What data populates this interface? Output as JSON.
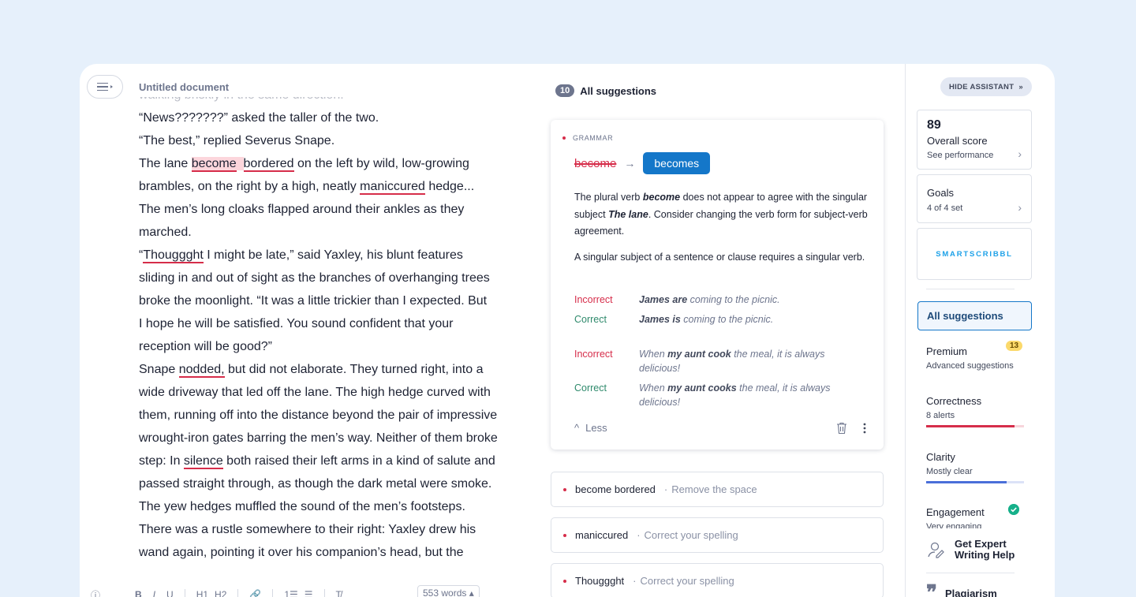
{
  "editor": {
    "title": "Untitled document",
    "faded_line": "walking briskly in the same direction.",
    "lines": [
      [
        {
          "t": "“News???????” asked the taller of the two."
        }
      ],
      [
        {
          "t": "“The best,” replied Severus Snape."
        }
      ],
      [
        {
          "t": "The lane "
        },
        {
          "t": "become",
          "s": "uh"
        },
        {
          "t": "  ",
          "s": "h"
        },
        {
          "t": "bordered",
          "s": "u"
        },
        {
          "t": " on the left by wild, low-growing"
        }
      ],
      [
        {
          "t": "brambles, on the right by a high, neatly "
        },
        {
          "t": "maniccured",
          "s": "u"
        },
        {
          "t": " hedge..."
        }
      ],
      [
        {
          "t": "The men’s long cloaks flapped around their ankles as they"
        }
      ],
      [
        {
          "t": "marched."
        }
      ],
      [
        {
          "t": "“"
        },
        {
          "t": "Thouggght",
          "s": "u"
        },
        {
          "t": " I might be late,” said Yaxley, his blunt features"
        }
      ],
      [
        {
          "t": "sliding in and out of sight as the branches of overhanging trees"
        }
      ],
      [
        {
          "t": "broke the moonlight. “It was a little trickier than I expected. But"
        }
      ],
      [
        {
          "t": "I hope he will be satisfied. You sound confident that your"
        }
      ],
      [
        {
          "t": "reception will be good?”"
        }
      ],
      [
        {
          "t": "Snape "
        },
        {
          "t": "nodded,",
          "s": "u"
        },
        {
          "t": " but did not elaborate. They turned right, into a"
        }
      ],
      [
        {
          "t": "wide driveway that led off the lane. The high hedge curved with"
        }
      ],
      [
        {
          "t": "them, running off into the distance beyond the pair of impressive"
        }
      ],
      [
        {
          "t": "wrought-iron gates barring the men’s way. Neither of them broke"
        }
      ],
      [
        {
          "t": "step: In "
        },
        {
          "t": "silence",
          "s": "u"
        },
        {
          "t": " both raised their left arms in a kind of salute and"
        }
      ],
      [
        {
          "t": "passed straight through, as though the dark metal were smoke."
        }
      ],
      [
        {
          "t": "The yew hedges muffled the sound of the men’s footsteps."
        }
      ],
      [
        {
          "t": "There was a rustle somewhere to their right: Yaxley drew his"
        }
      ],
      [
        {
          "t": "wand again, pointing it over his companion’s head, but the"
        }
      ]
    ],
    "toolbar": {
      "bold": "B",
      "italic": "I",
      "underline": "U",
      "h1": "H1",
      "h2": "H2",
      "link": "🔗",
      "ordered_list": "1☰",
      "bullet_list": "☰",
      "clear": "T̸"
    },
    "word_count": "553 words"
  },
  "suggestions": {
    "count": "10",
    "title": "All suggestions",
    "main_card": {
      "category": "GRAMMAR",
      "original": "become",
      "arrow": "→",
      "replacement": "becomes",
      "explanation_html": "The plural verb <b><i>become</i></b> does not appear to agree with the singular subject <b><i>The lane</i></b>. Consider changing the verb form for subject-verb agreement.",
      "explanation2": "A singular subject of a sentence or clause requires a singular verb.",
      "examples": [
        {
          "label": "Incorrect",
          "html": "<b>James are</b> coming to the picnic."
        },
        {
          "label": "Correct",
          "html": "<b>James is</b> coming to the picnic."
        },
        {
          "label": "Incorrect",
          "html": "When <b>my aunt cook</b> the meal, it is always delicious!"
        },
        {
          "label": "Correct",
          "html": "When <b>my aunt cooks</b> the meal, it is always delicious!"
        }
      ],
      "less_label": "Less"
    },
    "cards": [
      {
        "term": "become bordered",
        "sep": "·",
        "hint": "Remove the space"
      },
      {
        "term": "maniccured",
        "sep": "·",
        "hint": "Correct your spelling"
      },
      {
        "term": "Thouggght",
        "sep": "·",
        "hint": "Correct your spelling"
      }
    ]
  },
  "panel": {
    "hide_label": "HIDE ASSISTANT",
    "hide_chevrons": "»",
    "score": {
      "value": "89",
      "label": "Overall score",
      "sub": "See performance"
    },
    "goals": {
      "label": "Goals",
      "sub": "4 of 4 set"
    },
    "brand": "SMARTSCRIBBL",
    "all_suggestions": "All suggestions",
    "premium": {
      "label": "Premium",
      "sub": "Advanced suggestions",
      "badge": "13"
    },
    "correctness": {
      "label": "Correctness",
      "sub": "8 alerts",
      "level": 0.9,
      "color": "#d62d4a"
    },
    "clarity": {
      "label": "Clarity",
      "sub": "Mostly clear",
      "level": 0.82,
      "color": "#4a6fd9"
    },
    "engagement": {
      "label": "Engagement",
      "sub": "Very engaging"
    },
    "expert_help": {
      "line1": "Get Expert",
      "line2": "Writing Help"
    },
    "plagiarism": "Plagiarism"
  }
}
